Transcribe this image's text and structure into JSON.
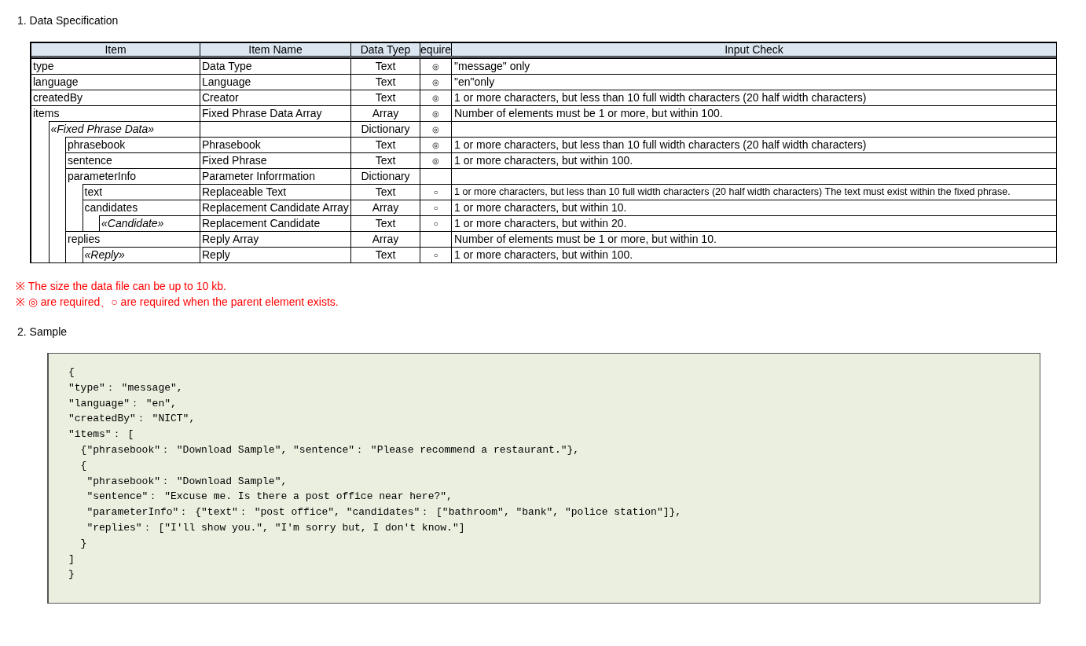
{
  "sections": [
    {
      "heading": "1. Data Specification"
    },
    {
      "heading": "2. Sample"
    }
  ],
  "table": {
    "columns": [
      "Item",
      "Item Name",
      "Data Tyep",
      "equire",
      "Input Check"
    ],
    "rows": [
      {
        "kind": "field",
        "item": "type",
        "name": "Data Type",
        "type": "Text",
        "required": "◎",
        "check": "\"message\" only"
      },
      {
        "kind": "field",
        "item": "language",
        "name": "Language",
        "type": "Text",
        "required": "◎",
        "check": "\"en\"only"
      },
      {
        "kind": "field",
        "item": "createdBy",
        "name": "Creator",
        "type": "Text",
        "required": "◎",
        "check": "1 or more characters, but less than 10 full width characters (20 half width characters)"
      },
      {
        "kind": "field",
        "item": "items",
        "name": "Fixed Phrase Data Array",
        "type": "Array",
        "required": "◎",
        "check": "Number of elements must be 1 or more,  but within 100.",
        "children": [
          {
            "kind": "element",
            "item": "«Fixed Phrase Data»",
            "type": "Dictionary",
            "required": "◎",
            "children": [
              {
                "kind": "field",
                "item": "phrasebook",
                "name": "Phrasebook",
                "type": "Text",
                "required": "◎",
                "check": "1 or more characters, but less than 10 full width characters (20 half width characters)"
              },
              {
                "kind": "field",
                "item": "sentence",
                "name": "Fixed Phrase",
                "type": "Text",
                "required": "◎",
                "check": "1 or more characters, but within 100."
              },
              {
                "kind": "field",
                "item": "parameterInfo",
                "name": "Parameter Inforrmation",
                "type": "Dictionary",
                "children": [
                  {
                    "kind": "field",
                    "item": "text",
                    "name": "Replaceable Text",
                    "type": "Text",
                    "required": "○",
                    "compact": true,
                    "check": "1 or more characters, but less than 10 full width characters (20 half width characters) The text must exist within the fixed phrase."
                  },
                  {
                    "kind": "field",
                    "item": "candidates",
                    "name": "Replacement Candidate Array",
                    "type": "Array",
                    "required": "○",
                    "check": "1 or more characters, but within 10.",
                    "children": [
                      {
                        "kind": "element",
                        "item": "«Candidate»",
                        "name": "Replacement Candidate",
                        "type": "Text",
                        "required": "○",
                        "check": "1 or more characters, but within 20."
                      }
                    ]
                  }
                ]
              },
              {
                "kind": "field",
                "item": "replies",
                "name": "Reply Array",
                "type": "Array",
                "check": "Number of elements must be 1 or more,  but within 10.",
                "children": [
                  {
                    "kind": "element",
                    "item": "«Reply»",
                    "name": "Reply",
                    "type": "Text",
                    "required": "○",
                    "check": "1 or more characters, but within 100."
                  }
                ]
              }
            ]
          }
        ]
      }
    ]
  },
  "notes": [
    "※ The size the data file can be up to 10 kb.",
    "※ ◎ are required、○ are required when the parent element exists."
  ],
  "sample": {
    "lines": [
      "{",
      "\"type\"： \"message\",",
      "\"language\"： \"en\",",
      "\"createdBy\"： \"NICT\",",
      "\"items\"： [",
      "  {\"phrasebook\"： \"Download Sample\", \"sentence\"： \"Please recommend a restaurant.\"},",
      "  {",
      "   \"phrasebook\"： \"Download Sample\",",
      "   \"sentence\"： \"Excuse me. Is there a post office near here?\",",
      "   \"parameterInfo\"： {\"text\"： \"post office\", \"candidates\"： [\"bathroom\", \"bank\", \"police station\"]},",
      "   \"replies\"： [\"I'll show you.\", \"I'm sorry but, I don't know.\"]",
      "  }",
      "]",
      "}"
    ]
  }
}
